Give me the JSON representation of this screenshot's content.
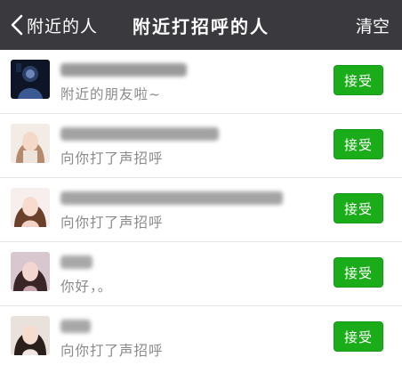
{
  "header": {
    "back_label": "附近的人",
    "title": "附近打招呼的人",
    "clear_label": "清空"
  },
  "greetings": [
    {
      "message": "附近的朋友啦~",
      "accept_label": "接受",
      "name_obscured": true
    },
    {
      "message": "向你打了声招呼",
      "accept_label": "接受",
      "name_obscured": true
    },
    {
      "message": "向你打了声招呼",
      "accept_label": "接受",
      "name_obscured": true
    },
    {
      "message": "你好，。",
      "accept_label": "接受",
      "name_obscured": true
    },
    {
      "message": "向你打了声招呼",
      "accept_label": "接受",
      "name_obscured": true
    }
  ],
  "colors": {
    "header_bg": "#3a393e",
    "accept_green": "#1aad19",
    "secondary_text": "#8a8a8a"
  },
  "icons": {
    "back": "chevron-left-icon"
  }
}
